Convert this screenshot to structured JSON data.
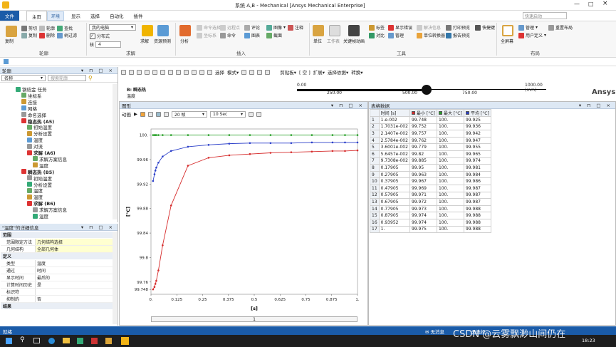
{
  "title": "系统 A,B - Mechanical [Ansys Mechanical Enterprise]",
  "quick_search_placeholder": "快速启动",
  "ribbon_tabs": [
    "文件",
    "主页",
    "结果",
    "显示",
    "选择",
    "自动化",
    "插件"
  ],
  "context_tab": "环境",
  "ribbon": {
    "groups": [
      "轮廓",
      "求解",
      "插入",
      "工具",
      "布局"
    ],
    "clipboard": {
      "paste": "复制",
      "cut": "剪切",
      "copy": "复制",
      "delete": "删除",
      "find": "查找",
      "tree": "树过滤",
      "duplicate": "轮廓"
    },
    "solve": {
      "mode": "我的电脑",
      "distributed": "分布式",
      "cores_label": "核",
      "cores": "4",
      "solve_btn": "求解",
      "resources": "资源预测"
    },
    "insert": {
      "analysis": "分析",
      "cmd": "命令选择",
      "coord": "坐标系",
      "comment": "评论",
      "image": "图像",
      "remark": "注释",
      "chart": "图表",
      "section": "截面",
      "cmds": "命令",
      "remote": "远程点",
      "note": "注释"
    },
    "tools": {
      "unit": "单位",
      "worksheet": "工作表",
      "keyframe": "关键帧动画",
      "tag": "标签",
      "show_error": "显示错误",
      "solution_info": "解决信息",
      "print": "打印预览",
      "shortcut": "快捷键",
      "manage": "管理",
      "unit_conv": "单位转换器",
      "report": "报告预览",
      "compare": "对比"
    },
    "layout": {
      "full": "全屏幕",
      "manage": "管理",
      "user": "用户定义",
      "reset": "重置布局"
    }
  },
  "outline": {
    "header": "轮廓",
    "filter_label": "名称",
    "search_placeholder": "搜索轮廓",
    "nodes": [
      {
        "label": "钢结金 任务",
        "indent": 0
      },
      {
        "label": "坐标系",
        "indent": 1
      },
      {
        "label": "连接",
        "indent": 1
      },
      {
        "label": "网格",
        "indent": 1
      },
      {
        "label": "命名选择",
        "indent": 1
      },
      {
        "label": "稳态热 (A5)",
        "indent": 1,
        "bold": true
      },
      {
        "label": "初始温度",
        "indent": 2
      },
      {
        "label": "分析设置",
        "indent": 2
      },
      {
        "label": "温度",
        "indent": 2
      },
      {
        "label": "对流",
        "indent": 2
      },
      {
        "label": "求解 (A6)",
        "indent": 2,
        "bold": true
      },
      {
        "label": "求解方案信息",
        "indent": 3
      },
      {
        "label": "温度",
        "indent": 3
      },
      {
        "label": "瞬态热 (B5)",
        "indent": 1,
        "bold": true
      },
      {
        "label": "初始温度",
        "indent": 2
      },
      {
        "label": "分析设置",
        "indent": 2
      },
      {
        "label": "温度",
        "indent": 2
      },
      {
        "label": "温度",
        "indent": 2
      },
      {
        "label": "求解 (B6)",
        "indent": 2,
        "bold": true
      },
      {
        "label": "求解方案信息",
        "indent": 3
      },
      {
        "label": "温度",
        "indent": 3
      }
    ]
  },
  "details": {
    "header": "\"温度\"的详细信息",
    "sections": [
      {
        "name": "范围",
        "rows": [
          [
            "范围限定方法",
            "几何结构选择"
          ],
          [
            "几何结构",
            "全部几何体"
          ]
        ]
      },
      {
        "name": "定义",
        "rows": [
          [
            "类型",
            "温度"
          ],
          [
            "通过",
            "时间"
          ],
          [
            "显示时间",
            "最后的"
          ],
          [
            "计算时间历史",
            "是"
          ],
          [
            "标识符",
            ""
          ],
          [
            "抑制的",
            "否"
          ]
        ]
      },
      {
        "name": "结果",
        "rows": []
      }
    ]
  },
  "graphics": {
    "item": "B: 瞬态热",
    "subitem": "温度",
    "scale_ticks": [
      "0.00",
      "250.00",
      "500.00",
      "750.00",
      "1000.00 (mm)"
    ],
    "logo": "Ansys"
  },
  "graph": {
    "header": "图形",
    "animation_label": "动画",
    "frames": "20 帧",
    "duration": "10 Sec",
    "page": "1"
  },
  "tabular": {
    "header": "表格数据",
    "columns": [
      "时间 [s]",
      "最小 [°C]",
      "最大 [°C]",
      "平均 [°C]"
    ],
    "rows": [
      [
        "1",
        "1.e-002",
        "99.748",
        "100.",
        "99.925"
      ],
      [
        "2",
        "1.7031e-002",
        "99.752",
        "100.",
        "99.936"
      ],
      [
        "3",
        "2.1407e-002",
        "99.757",
        "100.",
        "99.942"
      ],
      [
        "4",
        "2.5784e-002",
        "99.762",
        "100.",
        "99.947"
      ],
      [
        "5",
        "3.6001e-002",
        "99.779",
        "100.",
        "99.955"
      ],
      [
        "6",
        "5.6457e-002",
        "99.82",
        "100.",
        "99.965"
      ],
      [
        "7",
        "9.7308e-002",
        "99.885",
        "100.",
        "99.974"
      ],
      [
        "8",
        "0.17905",
        "99.95",
        "100.",
        "99.981"
      ],
      [
        "9",
        "0.27905",
        "99.963",
        "100.",
        "99.984"
      ],
      [
        "10",
        "0.37905",
        "99.967",
        "100.",
        "99.986"
      ],
      [
        "11",
        "0.47905",
        "99.969",
        "100.",
        "99.987"
      ],
      [
        "12",
        "0.57905",
        "99.971",
        "100.",
        "99.987"
      ],
      [
        "13",
        "0.67905",
        "99.972",
        "100.",
        "99.987"
      ],
      [
        "14",
        "0.77905",
        "99.973",
        "100.",
        "99.988"
      ],
      [
        "15",
        "0.87905",
        "99.974",
        "100.",
        "99.988"
      ],
      [
        "16",
        "0.93952",
        "99.974",
        "100.",
        "99.988"
      ],
      [
        "17",
        "1.",
        "99.975",
        "100.",
        "99.988"
      ]
    ]
  },
  "status": {
    "left": "就绪",
    "messages": "无消息",
    "selection": "无选择"
  },
  "taskbar": {
    "time": "18:23"
  },
  "watermark": "CSDN @云雾飘渺山间仍在",
  "colors": {
    "min": "#d62c2c",
    "max": "#2aa02a",
    "avg": "#2b3fc9",
    "accent": "#1a5ba8"
  },
  "chart_data": {
    "type": "line",
    "xlabel": "[s]",
    "ylabel": "[°C]",
    "xlim": [
      0,
      1
    ],
    "ylim": [
      99.74,
      100.01
    ],
    "x_ticks": [
      "0.",
      "0.125",
      "0.25",
      "0.375",
      "0.5",
      "0.625",
      "0.75",
      "0.875",
      "1."
    ],
    "y_ticks": [
      "99.748",
      "99.76",
      "99.8",
      "99.84",
      "99.88",
      "99.92",
      "99.96",
      "100."
    ],
    "x": [
      0.01,
      0.017031,
      0.021407,
      0.025784,
      0.036001,
      0.056457,
      0.097308,
      0.17905,
      0.27905,
      0.37905,
      0.47905,
      0.57905,
      0.67905,
      0.77905,
      0.87905,
      0.93952,
      1.0
    ],
    "series": [
      {
        "name": "最小",
        "color": "#d62c2c",
        "values": [
          99.748,
          99.752,
          99.757,
          99.762,
          99.779,
          99.82,
          99.885,
          99.95,
          99.963,
          99.967,
          99.969,
          99.971,
          99.972,
          99.973,
          99.974,
          99.974,
          99.975
        ]
      },
      {
        "name": "最大",
        "color": "#2aa02a",
        "values": [
          100,
          100,
          100,
          100,
          100,
          100,
          100,
          100,
          100,
          100,
          100,
          100,
          100,
          100,
          100,
          100,
          100
        ]
      },
      {
        "name": "平均",
        "color": "#2b3fc9",
        "values": [
          99.925,
          99.936,
          99.942,
          99.947,
          99.955,
          99.965,
          99.974,
          99.981,
          99.984,
          99.986,
          99.987,
          99.987,
          99.987,
          99.988,
          99.988,
          99.988,
          99.988
        ]
      }
    ]
  }
}
